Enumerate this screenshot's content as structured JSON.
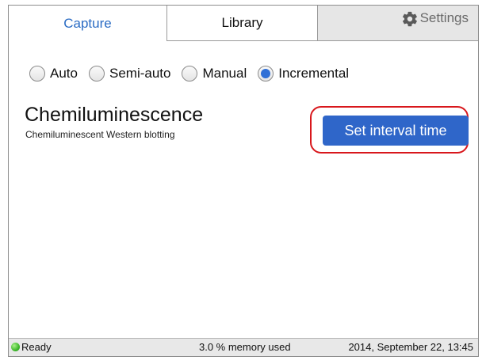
{
  "tabs": {
    "capture": "Capture",
    "library": "Library",
    "settings": "Settings"
  },
  "modes": {
    "auto": "Auto",
    "semi_auto": "Semi-auto",
    "manual": "Manual",
    "incremental": "Incremental",
    "selected": "Incremental"
  },
  "main": {
    "title": "Chemiluminescence",
    "subtitle": "Chemiluminescent Western blotting",
    "interval_button": "Set interval time"
  },
  "status": {
    "ready": "Ready",
    "memory": "3.0 % memory used",
    "datetime": "2014, September 22, 13:45"
  },
  "icons": {
    "settings": "gear-icon",
    "status": "status-led-icon"
  },
  "colors": {
    "accent": "#2f66c9",
    "active_tab_text": "#2b6cc4",
    "highlight": "#d8171c",
    "status_ok": "#3eb82b"
  }
}
